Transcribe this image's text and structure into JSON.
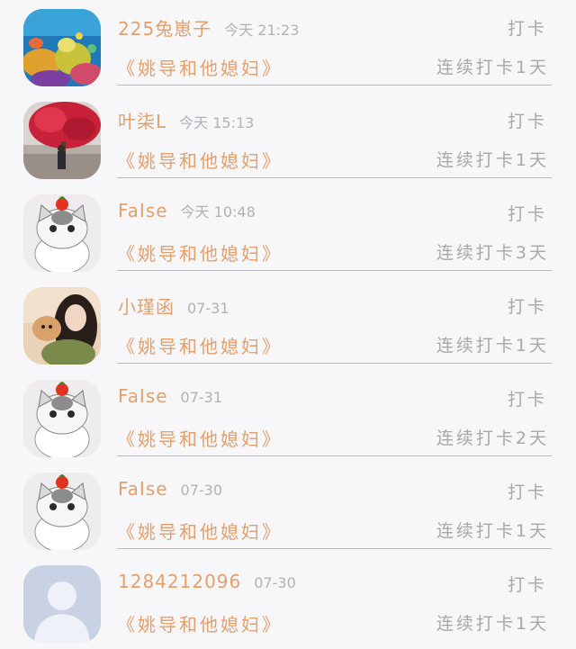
{
  "checkins": [
    {
      "avatar": "coral-reef-avatar",
      "name": "225兔崽子",
      "time": "今天 21:23",
      "action": "打卡",
      "title": "《姚导和他媳妇》",
      "streak": "连续打卡1天"
    },
    {
      "avatar": "red-tree-avatar",
      "name": "叶柒L",
      "time": "今天 15:13",
      "action": "打卡",
      "title": "《姚导和他媳妇》",
      "streak": "连续打卡1天"
    },
    {
      "avatar": "cat-tomato-avatar",
      "name": "FaIse",
      "time": "今天 10:48",
      "action": "打卡",
      "title": "《姚导和他媳妇》",
      "streak": "连续打卡3天"
    },
    {
      "avatar": "girl-dog-avatar",
      "name": "小瑾函",
      "time": "07-31",
      "action": "打卡",
      "title": "《姚导和他媳妇》",
      "streak": "连续打卡1天"
    },
    {
      "avatar": "cat-tomato-avatar",
      "name": "FaIse",
      "time": "07-31",
      "action": "打卡",
      "title": "《姚导和他媳妇》",
      "streak": "连续打卡2天"
    },
    {
      "avatar": "cat-tomato-avatar",
      "name": "FaIse",
      "time": "07-30",
      "action": "打卡",
      "title": "《姚导和他媳妇》",
      "streak": "连续打卡1天"
    },
    {
      "avatar": "default-person-avatar",
      "name": "1284212096",
      "time": "07-30",
      "action": "打卡",
      "title": "《姚导和他媳妇》",
      "streak": "连续打卡1天"
    }
  ],
  "colors": {
    "background": "#f7f6f8",
    "name_accent": "#e3a06d",
    "muted": "#a8a7aa",
    "divider": "#bcbabe"
  }
}
